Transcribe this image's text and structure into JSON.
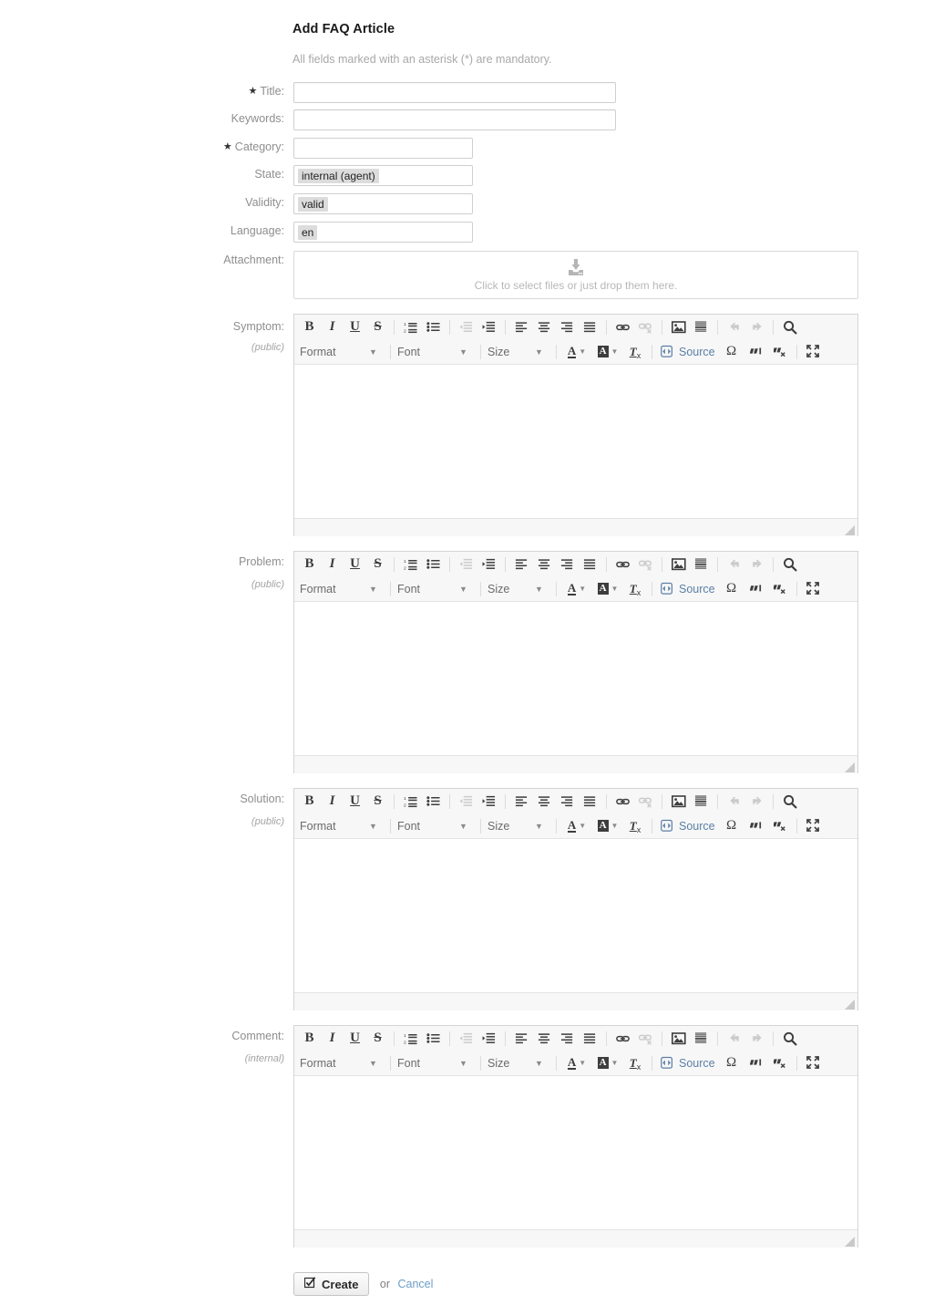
{
  "header": {
    "title": "Add FAQ Article",
    "subtitle": "All fields marked with an asterisk (*) are mandatory."
  },
  "fields": [
    {
      "label": "Title:",
      "required": true,
      "value": "",
      "placeholder": ""
    },
    {
      "label": "Keywords:",
      "required": false,
      "value": "",
      "placeholder": ""
    },
    {
      "label": "Category:",
      "required": true,
      "value": "",
      "placeholder": ""
    },
    {
      "label": "State:",
      "required": false,
      "value": "internal (agent)"
    },
    {
      "label": "Validity:",
      "required": false,
      "value": "valid"
    },
    {
      "label": "Language:",
      "required": false,
      "value": "en"
    }
  ],
  "attachment": {
    "label": "Attachment:",
    "icon": "download-icon",
    "hint": "Click to select files or just drop them here."
  },
  "editors": [
    {
      "label": "Symptom:",
      "visibility": "(public)"
    },
    {
      "label": "Problem:",
      "visibility": "(public)"
    },
    {
      "label": "Solution:",
      "visibility": "(public)"
    },
    {
      "label": "Comment:",
      "visibility": "(internal)"
    }
  ],
  "toolbar": {
    "row1": [
      {
        "name": "bold-icon",
        "title": "Bold",
        "disabled": false
      },
      {
        "name": "italic-icon",
        "title": "Italic",
        "disabled": false
      },
      {
        "name": "underline-icon",
        "title": "Underline",
        "disabled": false
      },
      {
        "name": "strikethrough-icon",
        "title": "Strike Through",
        "disabled": false
      },
      {
        "name": "separator",
        "title": "",
        "disabled": false
      },
      {
        "name": "numbered-list-icon",
        "title": "Insert/Remove Numbered List",
        "disabled": false
      },
      {
        "name": "bulleted-list-icon",
        "title": "Insert/Remove Bulleted List",
        "disabled": false
      },
      {
        "name": "separator",
        "title": "",
        "disabled": false
      },
      {
        "name": "outdent-icon",
        "title": "Decrease Indent",
        "disabled": true
      },
      {
        "name": "indent-icon",
        "title": "Increase Indent",
        "disabled": false
      },
      {
        "name": "separator",
        "title": "",
        "disabled": false
      },
      {
        "name": "align-left-icon",
        "title": "Align Left",
        "disabled": false
      },
      {
        "name": "align-center-icon",
        "title": "Center",
        "disabled": false
      },
      {
        "name": "align-right-icon",
        "title": "Align Right",
        "disabled": false
      },
      {
        "name": "justify-icon",
        "title": "Justify",
        "disabled": false
      },
      {
        "name": "separator",
        "title": "",
        "disabled": false
      },
      {
        "name": "link-icon",
        "title": "Link",
        "disabled": false
      },
      {
        "name": "unlink-icon",
        "title": "Unlink",
        "disabled": true
      },
      {
        "name": "separator",
        "title": "",
        "disabled": false
      },
      {
        "name": "image-icon",
        "title": "Image",
        "disabled": false
      },
      {
        "name": "horizontal-rule-icon",
        "title": "Horizontal Line",
        "disabled": false
      },
      {
        "name": "separator",
        "title": "",
        "disabled": false
      },
      {
        "name": "undo-icon",
        "title": "Undo",
        "disabled": true
      },
      {
        "name": "redo-icon",
        "title": "Redo",
        "disabled": true
      },
      {
        "name": "separator",
        "title": "",
        "disabled": false
      },
      {
        "name": "find-icon",
        "title": "Find",
        "disabled": false
      }
    ],
    "row2": {
      "format_label": "Format",
      "font_label": "Font",
      "size_label": "Size",
      "source_label": "Source",
      "buttons": [
        {
          "name": "text-color-icon",
          "title": "Text Color"
        },
        {
          "name": "bg-color-icon",
          "title": "Background Color"
        },
        {
          "name": "remove-format-icon",
          "title": "Remove Format"
        },
        {
          "name": "source-icon",
          "title": "Source"
        },
        {
          "name": "special-char-icon",
          "title": "Insert Special Character"
        },
        {
          "name": "add-quote-icon",
          "title": "Add Quote"
        },
        {
          "name": "remove-quote-icon",
          "title": "Remove Quote"
        },
        {
          "name": "maximize-icon",
          "title": "Maximize"
        }
      ]
    }
  },
  "footer": {
    "create_label": "Create",
    "or_label": "or",
    "cancel_label": "Cancel"
  },
  "colors": {
    "accent_link": "#6d9dc5",
    "source_link": "#5b7fa6",
    "label_gray": "#8e8e8e",
    "border": "#cfcfcf",
    "toolbar_bg": "#f7f7f7",
    "chip_bg": "#dcdcdc"
  }
}
